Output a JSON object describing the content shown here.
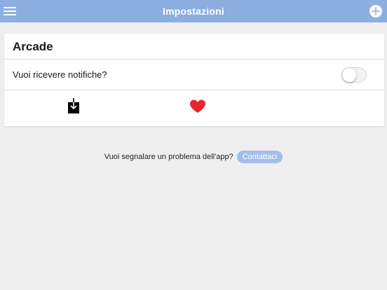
{
  "navbar": {
    "title": "Impostazioni",
    "menu_icon": "hamburger-menu-icon",
    "add_icon": "plus-circle-icon",
    "background": "#8caee0"
  },
  "card": {
    "title": "Arcade",
    "notification_label": "Vuoi ricevere notifiche?",
    "notification_toggle_on": false,
    "download_icon": "download-icon",
    "favorite_icon": "heart-icon",
    "favorite_color": "#e8252f"
  },
  "footer": {
    "report_text": "Vuoi segnalare un problema dell'app?",
    "contact_label": "Contattaci",
    "contact_color": "#a3bfe8"
  }
}
